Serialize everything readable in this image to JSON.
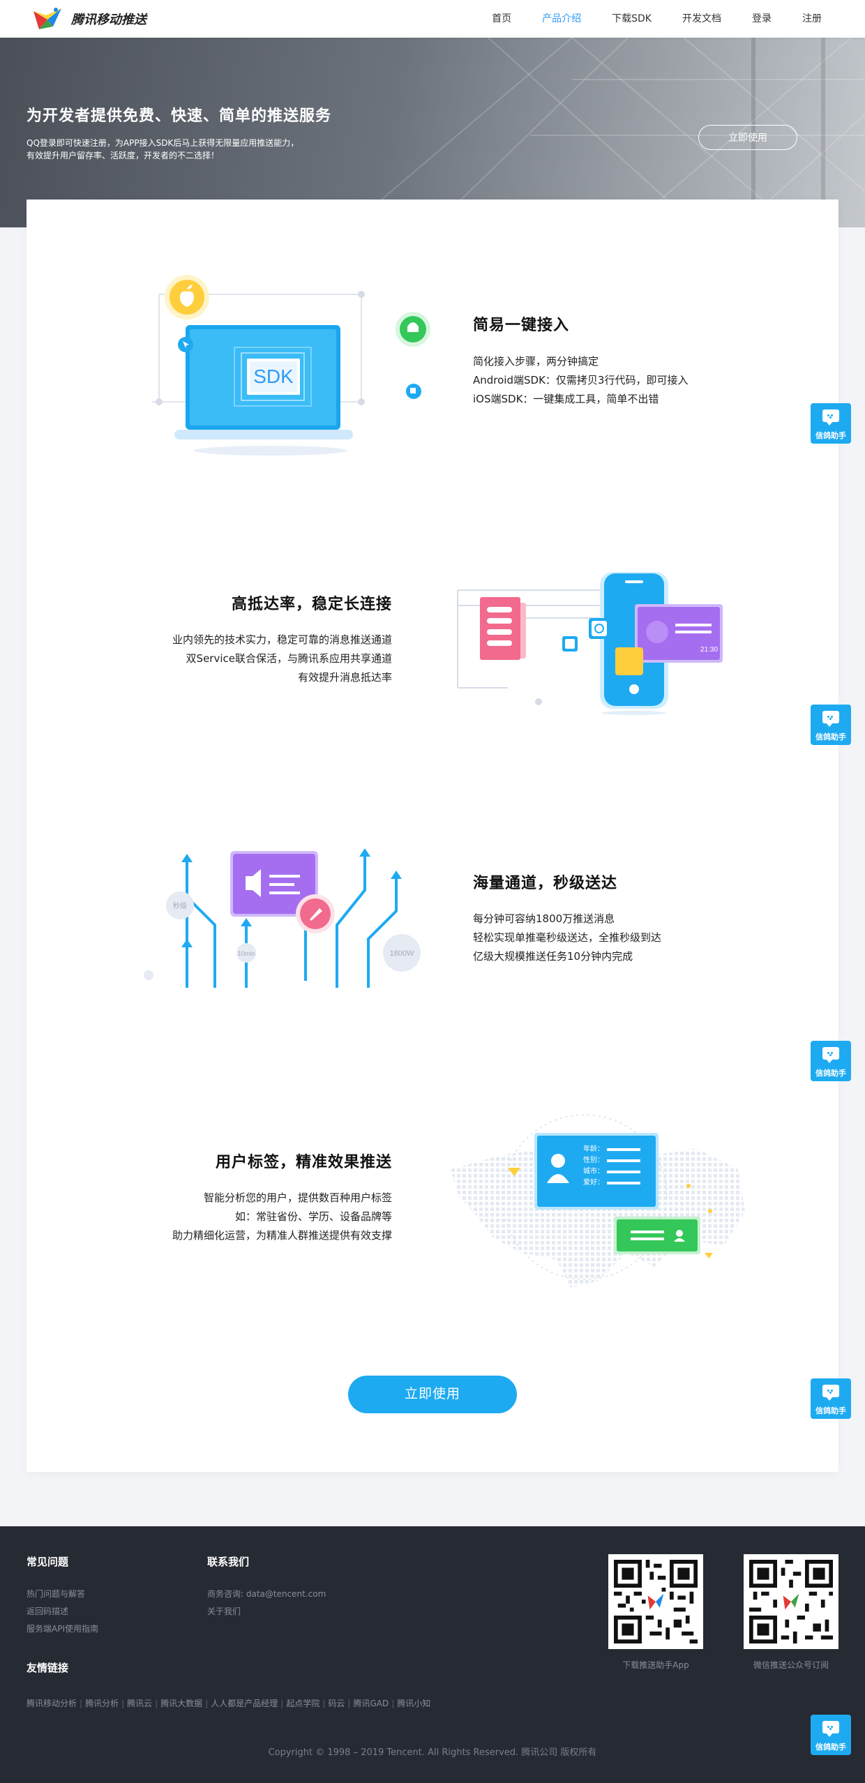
{
  "header": {
    "brand": "腾讯移动推送",
    "nav": [
      "首页",
      "产品介绍",
      "下载SDK",
      "开发文档",
      "登录",
      "注册"
    ],
    "active_nav": "产品介绍"
  },
  "hero": {
    "title": "为开发者提供免费、快速、简单的推送服务",
    "sub1": "QQ登录即可快速注册，为APP接入SDK后马上获得无限量应用推送能力，",
    "sub2": "有效提升用户留存率、活跃度，开发者的不二选择！",
    "button": "立即使用"
  },
  "features": [
    {
      "title": "简易一键接入",
      "lines": [
        "简化接入步骤，两分钟搞定",
        "Android端SDK：仅需拷贝3行代码，即可接入",
        "iOS端SDK：一键集成工具，简单不出错"
      ],
      "illus_text": "SDK"
    },
    {
      "title": "高抵达率，稳定长连接",
      "lines": [
        "业内领先的技术实力，稳定可靠的消息推送通道",
        "双Service联合保活，与腾讯系应用共享通道",
        "有效提升消息抵达率"
      ],
      "illus_time": "21:30"
    },
    {
      "title": "海量通道，秒级送达",
      "lines": [
        "每分钟可容纳1800万推送消息",
        "轻松实现单推毫秒级送达，全推秒级到达",
        "亿级大规模推送任务10分钟内完成"
      ],
      "illus_bubbles": [
        "秒级",
        "10min",
        "1800W"
      ]
    },
    {
      "title": "用户标签，精准效果推送",
      "lines": [
        "智能分析您的用户，提供数百种用户标签",
        "如：常驻省份、学历、设备品牌等",
        "助力精细化运营，为精准人群推送提供有效支撑"
      ],
      "illus_labels": [
        "年龄：",
        "性别：",
        "城市：",
        "爱好："
      ]
    }
  ],
  "cta": "立即使用",
  "helper_label": "信鸽助手",
  "footer": {
    "faq_title": "常见问题",
    "faq_links": [
      "热门问题与解答",
      "返回码描述",
      "服务端API使用指南"
    ],
    "contact_title": "联系我们",
    "contact_links": [
      "商务咨询: data@tencent.com",
      "关于我们"
    ],
    "friends_title": "友情链接",
    "friend_links": [
      "腾讯移动分析",
      "腾讯分析",
      "腾讯云",
      "腾讯大数据",
      "人人都是产品经理",
      "起点学院",
      "码云",
      "腾讯GAD",
      "腾讯小知"
    ],
    "qr1_caption": "下载推送助手App",
    "qr2_caption": "微信推送公众号订阅",
    "copyright": "Copyright © 1998 – 2019 Tencent. All Rights Reserved. 腾讯公司 版权所有"
  },
  "colors": {
    "accent": "#1eaaf1",
    "nav_active": "#2f9bf6",
    "footer_bg": "#262a33",
    "purple": "#a56ef0",
    "green": "#34c759",
    "yellow": "#ffce3d",
    "pink": "#f26a8d"
  }
}
